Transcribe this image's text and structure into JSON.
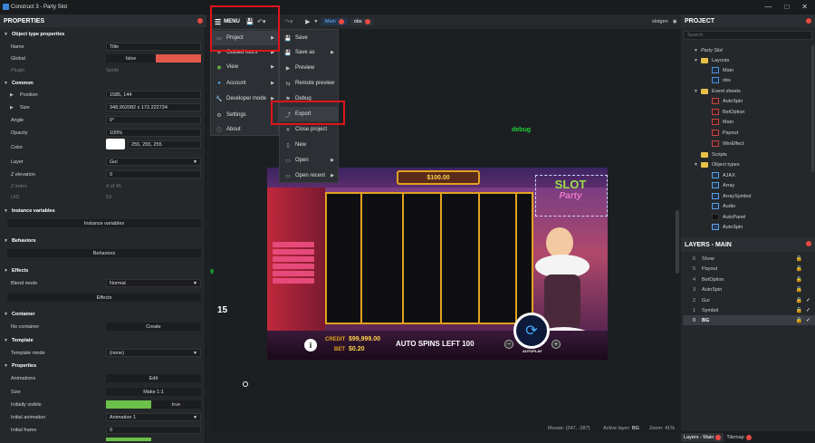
{
  "window": {
    "title": "Construct 3 - Party Slot",
    "controls": [
      "—",
      "□",
      "✕"
    ]
  },
  "toolbar": {
    "menu_label": "MENU",
    "tabs": [
      {
        "label": "Main",
        "active": true
      },
      {
        "label": "obs",
        "active": false
      }
    ],
    "user": "slotgen"
  },
  "properties": {
    "header": "PROPERTIES",
    "sections": {
      "object_type": "Object type properties",
      "common": "Common",
      "instance_variables": "Instance variables",
      "behaviors": "Behaviors",
      "effects": "Effects",
      "container": "Container",
      "template": "Template",
      "properties": "Properties"
    },
    "rows": {
      "name_k": "Name",
      "name_v": "Title",
      "global_k": "Global",
      "global_v": "false",
      "plugin_k": "Plugin",
      "plugin_v": "Sprite",
      "position_k": "Position",
      "position_v": "1585, 144",
      "size_k": "Size",
      "size_v": "348.902082 x 172.222734",
      "angle_k": "Angle",
      "angle_v": "0°",
      "opacity_k": "Opacity",
      "opacity_v": "100%",
      "color_k": "Color",
      "color_v": "255, 255, 255",
      "layer_k": "Layer",
      "layer_v": "Gui",
      "zelev_k": "Z elevation",
      "zelev_v": "0",
      "zindex_k": "Z index",
      "zindex_v": "4 of 45",
      "uid_k": "UID",
      "uid_v": "53",
      "instvars_btn": "Instance variables",
      "behaviors_btn": "Behaviors",
      "blend_k": "Blend mode",
      "blend_v": "Normal",
      "effects_btn": "Effects",
      "nocontainer_k": "No container",
      "create_btn": "Create",
      "tmplmode_k": "Template mode",
      "tmplmode_v": "(none)",
      "anims_k": "Animations",
      "edit_btn": "Edit",
      "psize_k": "Size",
      "make11_btn": "Make 1:1",
      "initvis_k": "Initially visible",
      "initvis_v": "true",
      "initanim_k": "Initial animation",
      "initanim_v": "Animation 1",
      "initframe_k": "Initial frame",
      "initframe_v": "0"
    }
  },
  "main_menu": {
    "items": [
      {
        "label": "Project",
        "icon": "project-icon",
        "has_sub": true
      },
      {
        "label": "Guided tours",
        "icon": "guided-tours-icon",
        "has_sub": true
      },
      {
        "label": "View",
        "icon": "view-icon",
        "has_sub": true
      },
      {
        "label": "Account",
        "icon": "account-icon",
        "has_sub": true
      },
      {
        "label": "Developer mode",
        "icon": "developer-icon",
        "has_sub": true
      },
      {
        "label": "Settings",
        "icon": "gear-icon",
        "has_sub": false
      },
      {
        "label": "About",
        "icon": "info-icon",
        "has_sub": false
      }
    ]
  },
  "project_menu": {
    "items": [
      {
        "label": "Save",
        "icon": "save-icon",
        "has_sub": false
      },
      {
        "label": "Save as",
        "icon": "save-as-icon",
        "has_sub": true
      },
      {
        "label": "Preview",
        "icon": "play-icon",
        "has_sub": false
      },
      {
        "label": "Remote preview",
        "icon": "remote-preview-icon",
        "has_sub": false
      },
      {
        "label": "Debug",
        "icon": "debug-icon",
        "has_sub": false
      },
      {
        "label": "Export",
        "icon": "export-icon",
        "has_sub": false
      },
      {
        "label": "Close project",
        "icon": "close-icon",
        "has_sub": false
      },
      {
        "label": "New",
        "icon": "new-file-icon",
        "has_sub": false
      },
      {
        "label": "Open",
        "icon": "open-folder-icon",
        "has_sub": true
      },
      {
        "label": "Open recent",
        "icon": "recent-icon",
        "has_sub": true
      }
    ]
  },
  "canvas": {
    "debug_text": "debug",
    "num_9": "9",
    "num_15": "15",
    "game": {
      "balance": "$100.00",
      "logo_line1": "SLOT",
      "logo_line2": "Party",
      "credit_label": "CREDIT",
      "credit_value": "$99,999.00",
      "bet_label": "BET",
      "bet_value": "$0.20",
      "autospins": "AUTO SPINS LEFT 100",
      "autoplay": "AUTOPLAY",
      "info": "i",
      "minus": "−",
      "plus": "+"
    }
  },
  "status": {
    "mouse": "Mouse: (247, -287)",
    "active_layer_label": "Active layer:",
    "active_layer": "BG",
    "zoom": "Zoom: 41%"
  },
  "project": {
    "header": "PROJECT",
    "search_placeholder": "Search",
    "root": "Party Slot",
    "layouts_folder": "Layouts",
    "layouts": [
      "Main",
      "obs"
    ],
    "event_sheets_folder": "Event sheets",
    "event_sheets": [
      "AutoSpin",
      "BetOption",
      "Main",
      "Payout",
      "WinEffect"
    ],
    "scripts_folder": "Scripts",
    "object_types_folder": "Object types",
    "object_types": [
      "AJAX",
      "Array",
      "ArraySymbol",
      "Audio",
      "AutoPanel",
      "AutoSpin"
    ]
  },
  "layers": {
    "header": "LAYERS - MAIN",
    "rows": [
      {
        "n": "6",
        "name": "Show",
        "visible": false,
        "selected": false
      },
      {
        "n": "5",
        "name": "Payout",
        "visible": false,
        "selected": false
      },
      {
        "n": "4",
        "name": "BetOption",
        "visible": false,
        "selected": false
      },
      {
        "n": "3",
        "name": "AutoSpin",
        "visible": false,
        "selected": false
      },
      {
        "n": "2",
        "name": "Gui",
        "visible": true,
        "selected": false
      },
      {
        "n": "1",
        "name": "Symbol",
        "visible": true,
        "selected": false
      },
      {
        "n": "0",
        "name": "BG",
        "visible": true,
        "selected": true
      }
    ],
    "bottom_tabs": [
      {
        "label": "Layers - Main"
      },
      {
        "label": "Tilemap"
      }
    ]
  },
  "colors": {
    "accent_red": "#e84a43",
    "highlight_red": "#e0141b",
    "gold": "#e3a11f",
    "green_debug": "#1ed23a"
  }
}
